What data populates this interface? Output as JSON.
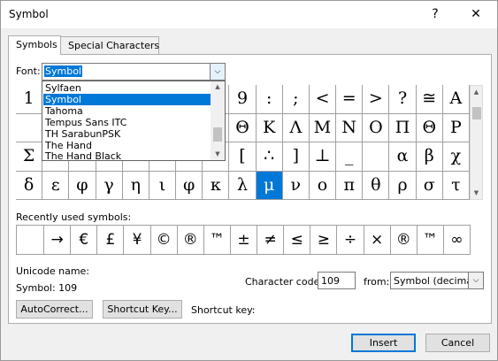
{
  "window": {
    "title": "Symbol",
    "help": "?",
    "close": "✕"
  },
  "tabs": [
    {
      "label": "Symbols",
      "active": true
    },
    {
      "label": "Special Characters",
      "active": false
    }
  ],
  "font": {
    "label": "Font:",
    "value": "Symbol",
    "options": [
      "Sylfaen",
      "Symbol",
      "Tahoma",
      "Tempus Sans ITC",
      "TH SarabunPSK",
      "The Hand",
      "The Hand Black"
    ],
    "highlighted": "Symbol"
  },
  "symbol_grid": {
    "rows": [
      [
        "1",
        "",
        "",
        "",
        "",
        "",
        "",
        "",
        "9",
        ":",
        ";",
        "<",
        "=",
        ">",
        "?",
        "≅",
        "A"
      ],
      [
        "",
        "",
        "",
        "",
        "",
        "",
        "",
        "",
        "Θ",
        "Κ",
        "Λ",
        "Μ",
        "Ν",
        "Ο",
        "Π",
        "Θ",
        "Ρ"
      ],
      [
        "Σ",
        "",
        "",
        "",
        "",
        "",
        "",
        "",
        "[",
        "∴",
        "]",
        "⊥",
        "_",
        "",
        "α",
        "β",
        "χ"
      ],
      [
        "δ",
        "ε",
        "φ",
        "γ",
        "η",
        "ι",
        "φ",
        "κ",
        "λ",
        "μ",
        "ν",
        "ο",
        "π",
        "θ",
        "ρ",
        "σ",
        "τ"
      ]
    ],
    "selected": "μ"
  },
  "recent": {
    "label": "Recently used symbols:",
    "symbols": [
      "",
      "→",
      "€",
      "£",
      "¥",
      "©",
      "®",
      "™",
      "±",
      "≠",
      "≤",
      "≥",
      "÷",
      "×",
      "®",
      "™",
      "∞"
    ]
  },
  "unicode_name": {
    "label": "Unicode name:",
    "value": "Symbol: 109"
  },
  "character_code": {
    "label": "Character code:",
    "value": "109"
  },
  "from": {
    "label": "from:",
    "value": "Symbol (decimal)"
  },
  "buttons": {
    "autocorrect": "AutoCorrect...",
    "shortcut_key": "Shortcut Key...",
    "insert": "Insert",
    "cancel": "Cancel"
  },
  "shortcut_key_label": "Shortcut key:",
  "colors": {
    "accent": "#0078d7",
    "dialog_bg": "#f0f0f0"
  }
}
